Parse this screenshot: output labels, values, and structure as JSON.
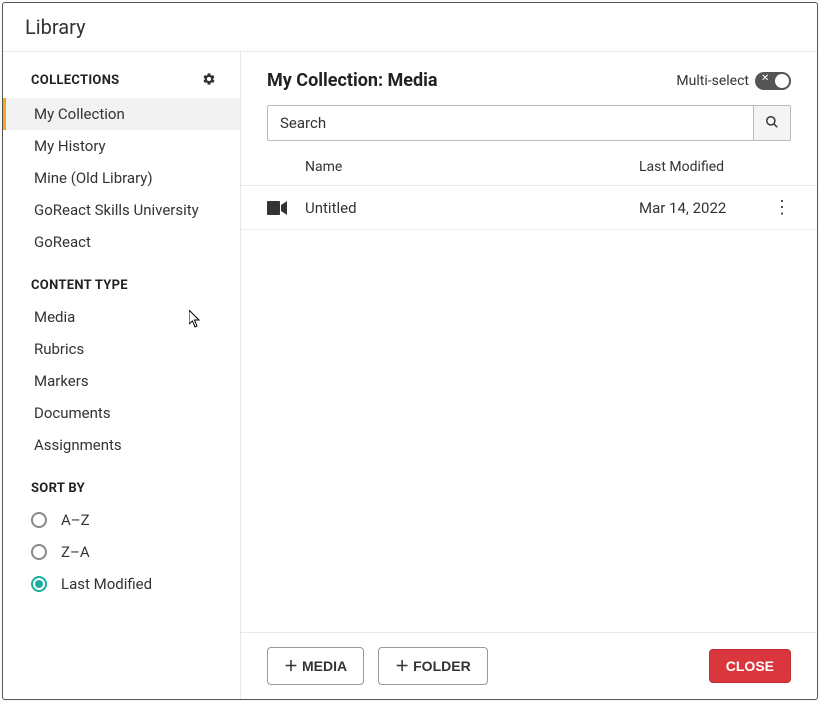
{
  "dialog": {
    "title": "Library"
  },
  "sidebar": {
    "collections_heading": "COLLECTIONS",
    "collections": [
      {
        "label": "My Collection",
        "active": true
      },
      {
        "label": "My History",
        "active": false
      },
      {
        "label": "Mine (Old Library)",
        "active": false
      },
      {
        "label": "GoReact Skills University",
        "active": false
      },
      {
        "label": "GoReact",
        "active": false
      }
    ],
    "content_type_heading": "CONTENT TYPE",
    "content_types": [
      {
        "label": "Media"
      },
      {
        "label": "Rubrics"
      },
      {
        "label": "Markers"
      },
      {
        "label": "Documents"
      },
      {
        "label": "Assignments"
      }
    ],
    "sort_heading": "SORT BY",
    "sort_options": [
      {
        "label": "A–Z",
        "selected": false
      },
      {
        "label": "Z–A",
        "selected": false
      },
      {
        "label": "Last Modified",
        "selected": true
      }
    ]
  },
  "main": {
    "title": "My Collection: Media",
    "multi_select_label": "Multi-select",
    "multi_select_on": false,
    "search_label": "Search",
    "columns": {
      "name": "Name",
      "last_modified": "Last Modified"
    },
    "rows": [
      {
        "icon": "video",
        "name": "Untitled",
        "last_modified": "Mar 14, 2022"
      }
    ]
  },
  "footer": {
    "add_media": "MEDIA",
    "add_folder": "FOLDER",
    "close": "CLOSE"
  }
}
